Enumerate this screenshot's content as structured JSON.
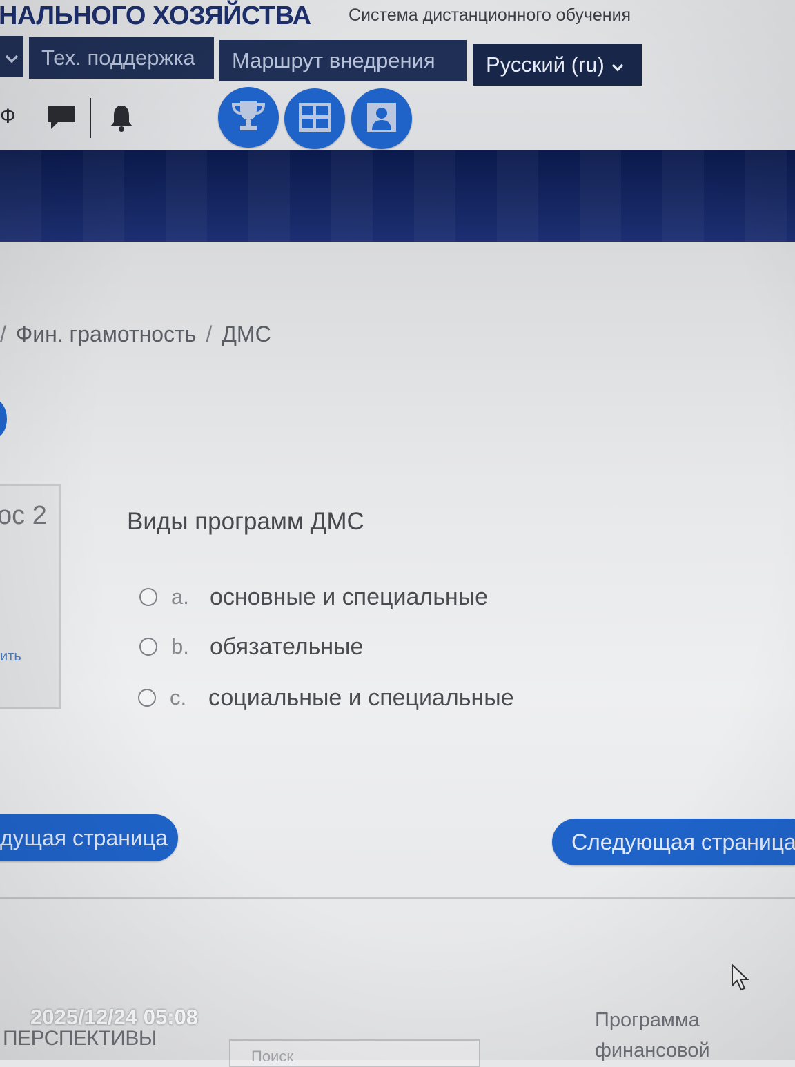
{
  "header": {
    "org_title": "НАЛЬНОГО ХОЗЯЙСТВА",
    "system_name": "Система дистанционного обучения"
  },
  "nav": {
    "support_label": "Тех. поддержка",
    "route_label": "Маршрут внедрения",
    "language_label": "Русский (ru)",
    "phi_glyph": "Ф"
  },
  "icons": {
    "chat": "chat-icon",
    "bell": "bell-icon",
    "trophy": "trophy-icon",
    "grid": "grid-icon",
    "person": "person-card-icon",
    "accent_color": "#1f63c9",
    "nav_color": "#1f2f55"
  },
  "breadcrumb": {
    "items": [
      "Фин. грамотность",
      "ДМС"
    ],
    "separator": "/"
  },
  "question_info": {
    "number_label": "ос 2",
    "link_label": "ить"
  },
  "question": {
    "text": "Виды программ ДМС",
    "options": [
      {
        "letter": "a.",
        "text": "основные и специальные"
      },
      {
        "letter": "b.",
        "text": "обязательные"
      },
      {
        "letter": "c.",
        "text": "социальные и специальные"
      }
    ]
  },
  "navigation": {
    "prev_label": "дущая страница",
    "next_label": "Следующая страница"
  },
  "footer": {
    "left_text": "ПЕРСПЕКТИВЫ",
    "right_text_line1": "Программа",
    "right_text_line2": "финансовой",
    "input_placeholder": "Поиск"
  },
  "photo_timestamp": "2025/12/24 05:08"
}
